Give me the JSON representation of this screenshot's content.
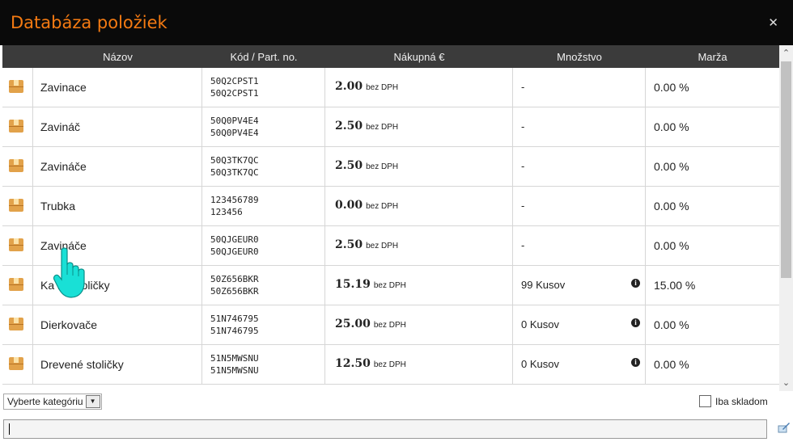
{
  "window": {
    "title": "Databáza položiek",
    "close_icon": "close-icon"
  },
  "table": {
    "headers": [
      "Názov",
      "Kód / Part. no.",
      "Nákupná €",
      "Množstvo",
      "Marža"
    ],
    "price_suffix": "bez DPH",
    "rows": [
      {
        "name": "Zavinace",
        "code1": "50Q2CPST1",
        "code2": "50Q2CPST1",
        "price": "2.00",
        "qty": "-",
        "info": false,
        "marza": "0.00 %"
      },
      {
        "name": "Zavináč",
        "code1": "50Q0PV4E4",
        "code2": "50Q0PV4E4",
        "price": "2.50",
        "qty": "-",
        "info": false,
        "marza": "0.00 %"
      },
      {
        "name": "Zavináče",
        "code1": "50Q3TK7QC",
        "code2": "50Q3TK7QC",
        "price": "2.50",
        "qty": "-",
        "info": false,
        "marza": "0.00 %"
      },
      {
        "name": "Trubka",
        "code1": "123456789",
        "code2": "123456",
        "price": "0.00",
        "qty": "-",
        "info": false,
        "marza": "0.00 %"
      },
      {
        "name": "Zavináče",
        "code1": "50QJGEUR0",
        "code2": "50QJGEUR0",
        "price": "2.50",
        "qty": "-",
        "info": false,
        "marza": "0.00 %"
      },
      {
        "name": "Ka            ke stoličky",
        "code1": "50Z656BKR",
        "code2": "50Z656BKR",
        "price": "15.19",
        "qty": "99 Kusov",
        "info": true,
        "marza": "15.00 %"
      },
      {
        "name": "Dierkovače",
        "code1": "51N746795",
        "code2": "51N746795",
        "price": "25.00",
        "qty": "0 Kusov",
        "info": true,
        "marza": "0.00 %"
      },
      {
        "name": "Drevené stoličky",
        "code1": "51N5MWSNU",
        "code2": "51N5MWSNU",
        "price": "12.50",
        "qty": "0 Kusov",
        "info": true,
        "marza": "0.00 %"
      }
    ]
  },
  "footer": {
    "category_select": "Vyberte kategóriu",
    "stock_checkbox_label": "Iba skladom",
    "search_value": ""
  },
  "colors": {
    "title": "#f47a12",
    "header_bg": "#3b3b3b",
    "titlebar_bg": "#0a0a0a",
    "hand_cursor": "#19e0d6"
  }
}
